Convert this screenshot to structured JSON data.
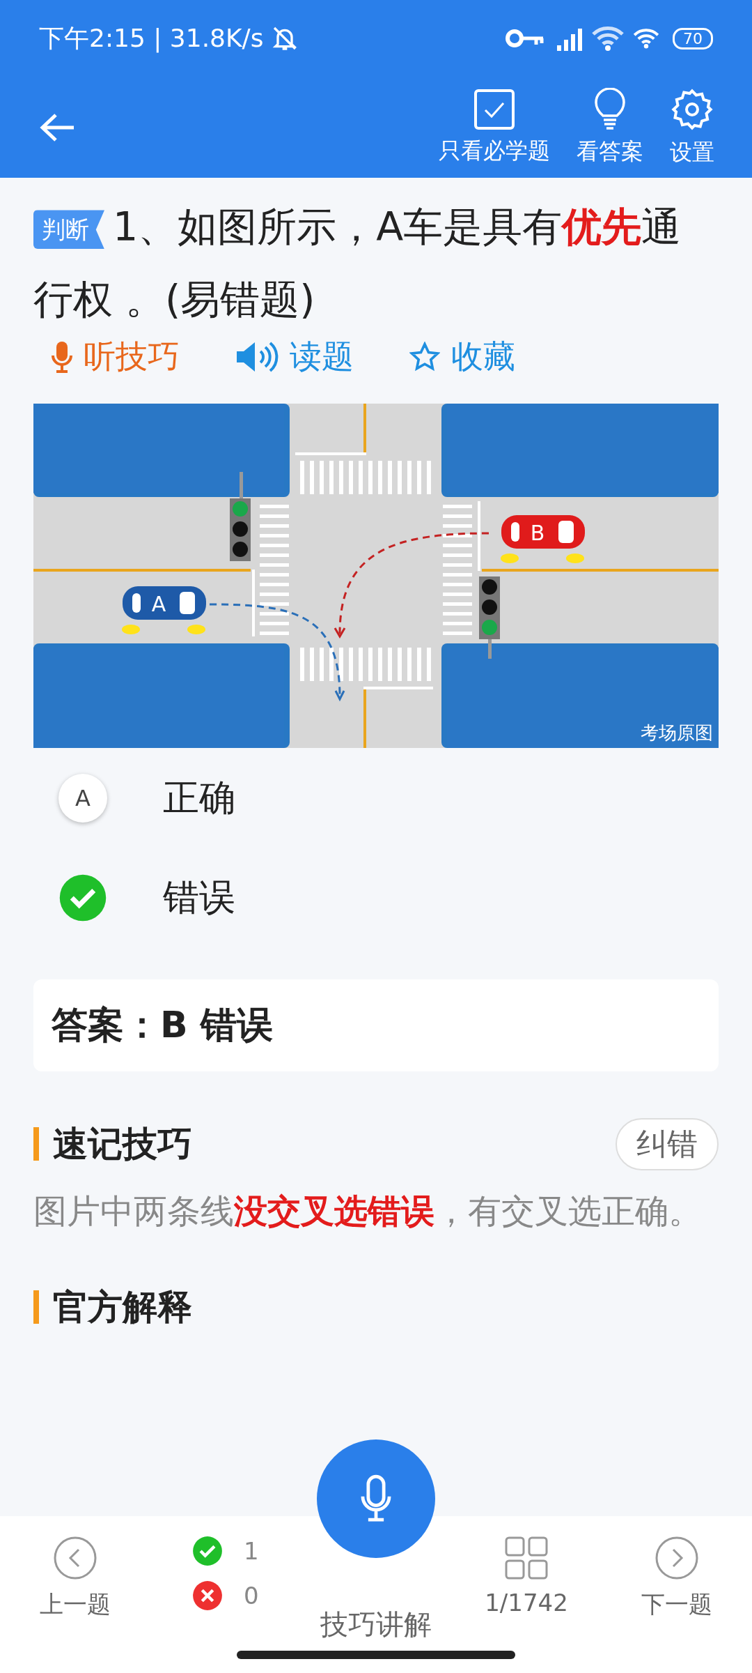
{
  "status_bar": {
    "time": "下午2:15 | 31.8K/s",
    "battery": "70"
  },
  "header": {
    "actions": [
      {
        "kind": "check",
        "label": "只看必学题"
      },
      {
        "kind": "bulb",
        "label": "看答案"
      },
      {
        "kind": "gear",
        "label": "设置"
      }
    ]
  },
  "question": {
    "type_tag": "判断",
    "text": "1、如图所示，A车是具有**优先**通行权 。(易错题)"
  },
  "tools": [
    {
      "kind": "mic",
      "label": "听技巧",
      "color": "#e8671c"
    },
    {
      "kind": "speaker",
      "label": "读题",
      "color": "#1f8fe0"
    },
    {
      "kind": "star",
      "label": "收藏",
      "color": "#1f8fe0"
    }
  ],
  "figure": {
    "car_a": "A",
    "car_b": "B",
    "caption": "考场原图"
  },
  "options": [
    {
      "letter": "A",
      "text": "正确",
      "selected": false
    },
    {
      "text": "错误",
      "selected": true
    }
  ],
  "answer": "答案：B 错误",
  "sections": [
    {
      "title": "速记技巧",
      "button": "纠错",
      "text": "图片中两条线**没交叉选错误**，有交叉选正确。"
    },
    {
      "title": "官方解释"
    }
  ],
  "bottom_bar": {
    "prev": "上一题",
    "correct_count": "1",
    "wrong_count": "0",
    "center": "技巧讲解",
    "progress": "1/1742",
    "next": "下一题"
  }
}
